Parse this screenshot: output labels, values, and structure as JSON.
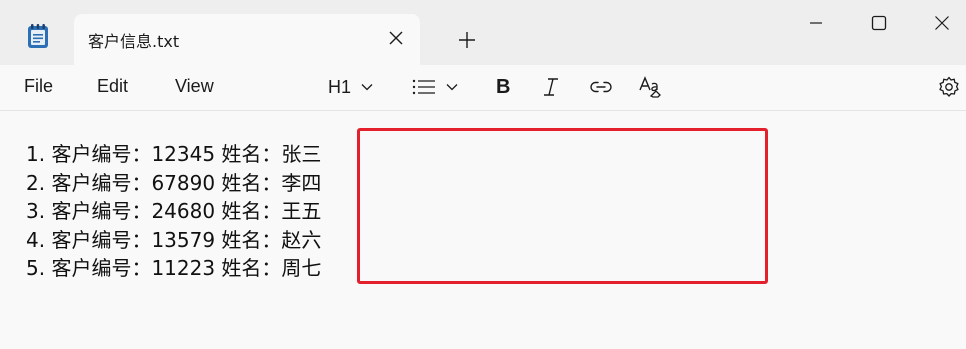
{
  "window": {
    "tab_title": "客户信息.txt",
    "icons": [
      "notepad-app-icon",
      "close-icon",
      "plus-icon",
      "minimize-icon",
      "maximize-icon",
      "window-close-icon"
    ]
  },
  "menu": {
    "file": "File",
    "edit": "Edit",
    "view": "View"
  },
  "toolbar": {
    "heading": "H1",
    "icons": [
      "chevron-down-icon",
      "list-icon",
      "bold-icon",
      "italic-icon",
      "link-icon",
      "clear-formatting-icon",
      "settings-icon"
    ],
    "bold_label": "B"
  },
  "document": {
    "lines": [
      "1. 客户编号：12345 姓名：张三",
      "2. 客户编号：67890 姓名：李四",
      "3. 客户编号：24680 姓名：王五",
      "4. 客户编号：13579 姓名：赵六",
      "5. 客户编号：11223 姓名：周七"
    ]
  },
  "colors": {
    "highlight_border": "#e3202c",
    "titlebar_bg": "#eeeeee",
    "editor_bg": "#f9f9f9"
  }
}
